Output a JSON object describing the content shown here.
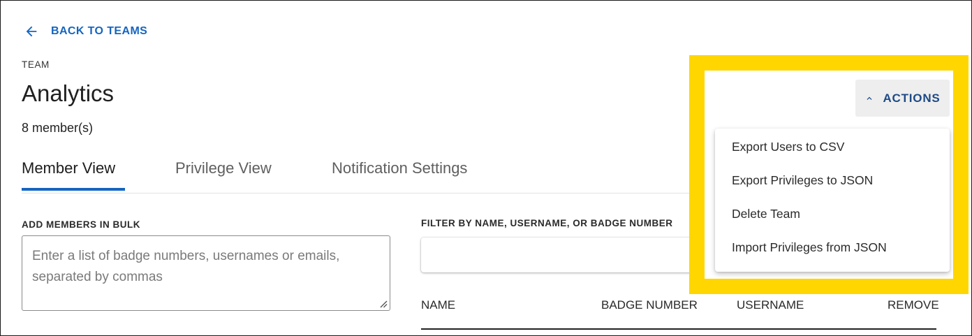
{
  "header": {
    "back_label": "BACK TO TEAMS",
    "team_label": "TEAM",
    "team_name": "Analytics",
    "member_count": "8 member(s)"
  },
  "tabs": [
    {
      "label": "Member View",
      "active": true
    },
    {
      "label": "Privilege View",
      "active": false
    },
    {
      "label": "Notification Settings",
      "active": false
    }
  ],
  "bulk": {
    "label": "ADD MEMBERS IN BULK",
    "placeholder": "Enter a list of badge numbers, usernames or emails, separated by commas"
  },
  "filter": {
    "label": "FILTER BY NAME, USERNAME, OR BADGE NUMBER",
    "value": ""
  },
  "table": {
    "columns": [
      "NAME",
      "BADGE NUMBER",
      "USERNAME",
      "REMOVE"
    ]
  },
  "actions": {
    "label": "ACTIONS",
    "expanded": true,
    "menu": [
      "Export Users to CSV",
      "Export Privileges to JSON",
      "Delete Team",
      "Import Privileges from JSON"
    ]
  },
  "colors": {
    "accent": "#1565c0",
    "highlight": "#ffd600",
    "actions_text": "#1e4a86"
  },
  "icons": {
    "back": "arrow-left-icon",
    "actions": "chevron-up-icon",
    "textarea": "resize-grip-icon"
  }
}
